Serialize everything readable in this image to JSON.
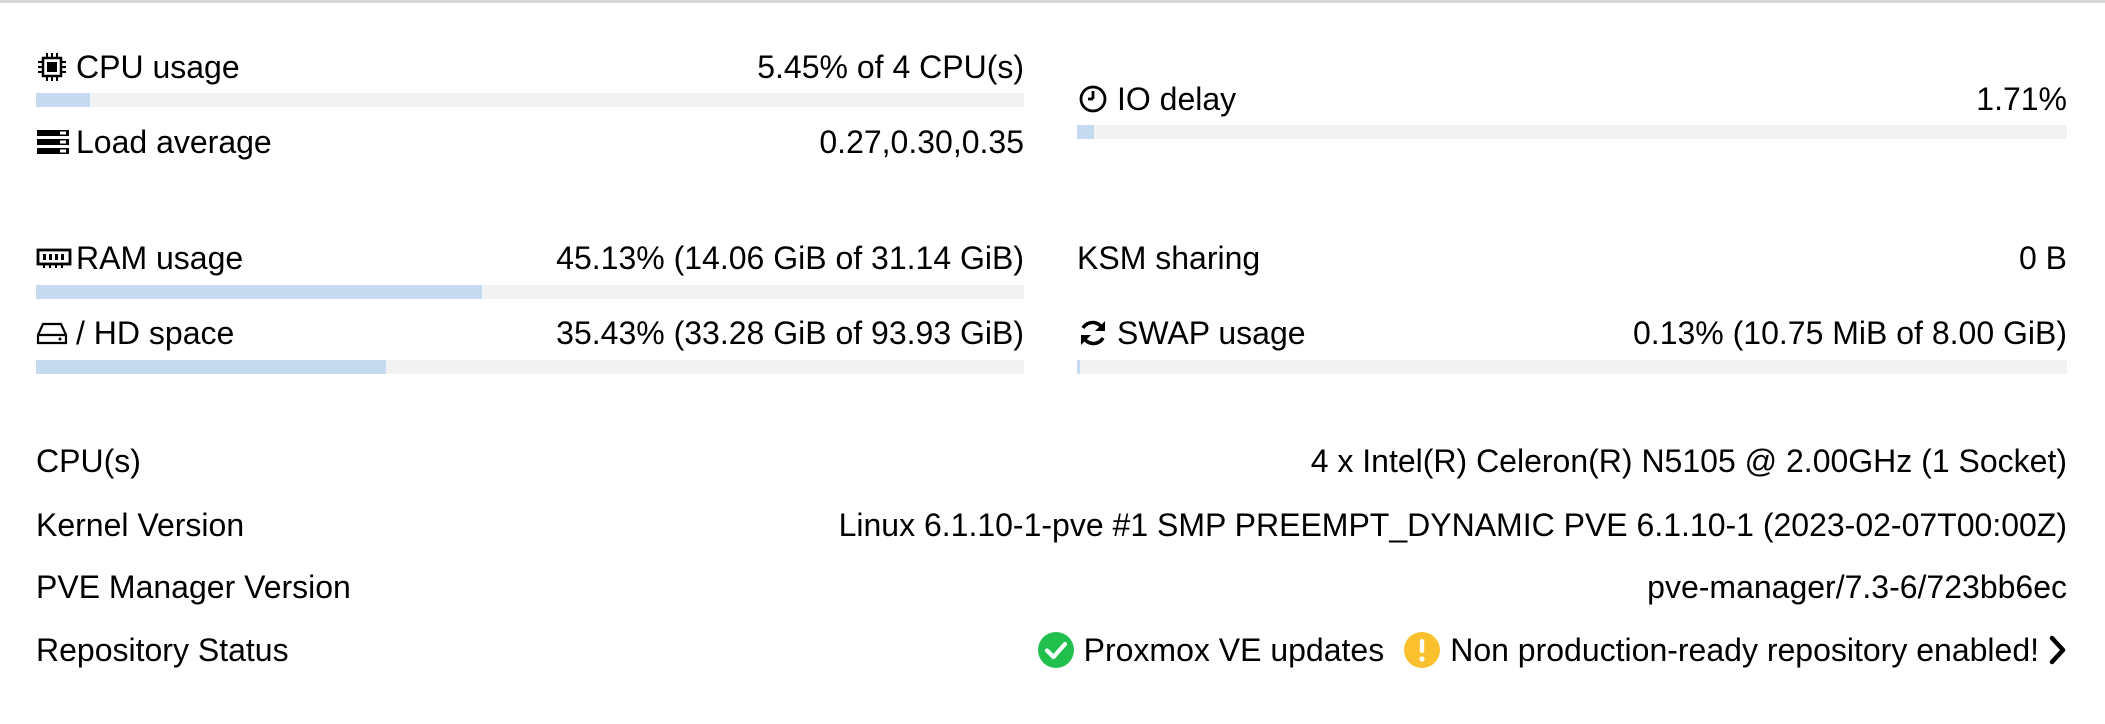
{
  "usage": {
    "cpu": {
      "label": "CPU usage",
      "value": "5.45% of 4 CPU(s)",
      "percent": 5.45,
      "icon": "cpu-chip-icon"
    },
    "load": {
      "label": "Load average",
      "value": "0.27,0.30,0.35",
      "icon": "server-stack-icon"
    },
    "io": {
      "label": "IO delay",
      "value": "1.71%",
      "percent": 1.71,
      "icon": "clock-icon"
    },
    "ram": {
      "label": "RAM usage",
      "value": "45.13% (14.06 GiB of 31.14 GiB)",
      "percent": 45.13,
      "icon": "memory-icon"
    },
    "ksm": {
      "label": "KSM sharing",
      "value": "0 B"
    },
    "hd": {
      "label": "/ HD space",
      "value": "35.43% (33.28 GiB of 93.93 GiB)",
      "percent": 35.43,
      "icon": "hdd-icon"
    },
    "swap": {
      "label": "SWAP usage",
      "value": "0.13% (10.75 MiB of 8.00 GiB)",
      "percent": 0.13,
      "icon": "refresh-icon"
    }
  },
  "info": {
    "cpus": {
      "label": "CPU(s)",
      "value": "4 x Intel(R) Celeron(R) N5105 @ 2.00GHz (1 Socket)"
    },
    "kernel": {
      "label": "Kernel Version",
      "value": "Linux 6.1.10-1-pve #1 SMP PREEMPT_DYNAMIC PVE 6.1.10-1 (2023-02-07T00:00Z)"
    },
    "manager": {
      "label": "PVE Manager Version",
      "value": "pve-manager/7.3-6/723bb6ec"
    },
    "repo": {
      "label": "Repository Status",
      "ok_text": "Proxmox VE updates",
      "warn_text": "Non production-ready repository enabled!",
      "ok_icon": "check-circle-icon",
      "warn_icon": "warning-circle-icon",
      "link_icon": "chevron-right-icon"
    }
  },
  "colors": {
    "bar_track": "#f2f2f2",
    "bar_fill": "#c5daef",
    "ok_green": "#21bf4b",
    "warn_yellow": "#fbc02d"
  }
}
